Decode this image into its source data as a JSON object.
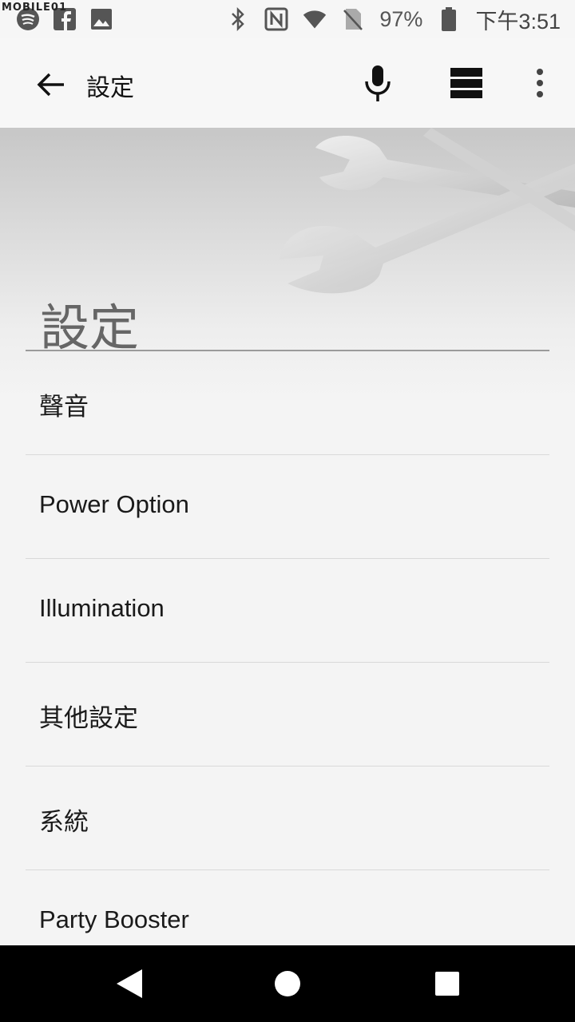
{
  "status_bar": {
    "watermark": "MOBILE01",
    "battery": "97%",
    "time": "下午3:51",
    "icons_left": [
      "spotify-icon",
      "facebook-icon",
      "image-icon"
    ],
    "icons_right": [
      "bluetooth-icon",
      "nfc-icon",
      "wifi-icon",
      "no-sim-icon",
      "battery-icon"
    ]
  },
  "toolbar": {
    "title": "設定",
    "icons": [
      "back-arrow-icon",
      "mic-icon",
      "grid-icon",
      "more-vert-icon"
    ]
  },
  "hero": {
    "title": "設定"
  },
  "list": {
    "items": [
      {
        "label": "聲音"
      },
      {
        "label": "Power Option"
      },
      {
        "label": "Illumination"
      },
      {
        "label": "其他設定"
      },
      {
        "label": "系統"
      },
      {
        "label": "Party Booster"
      }
    ]
  },
  "nav_bar": {
    "icons": [
      "back-triangle-icon",
      "home-circle-icon",
      "recents-square-icon"
    ]
  }
}
